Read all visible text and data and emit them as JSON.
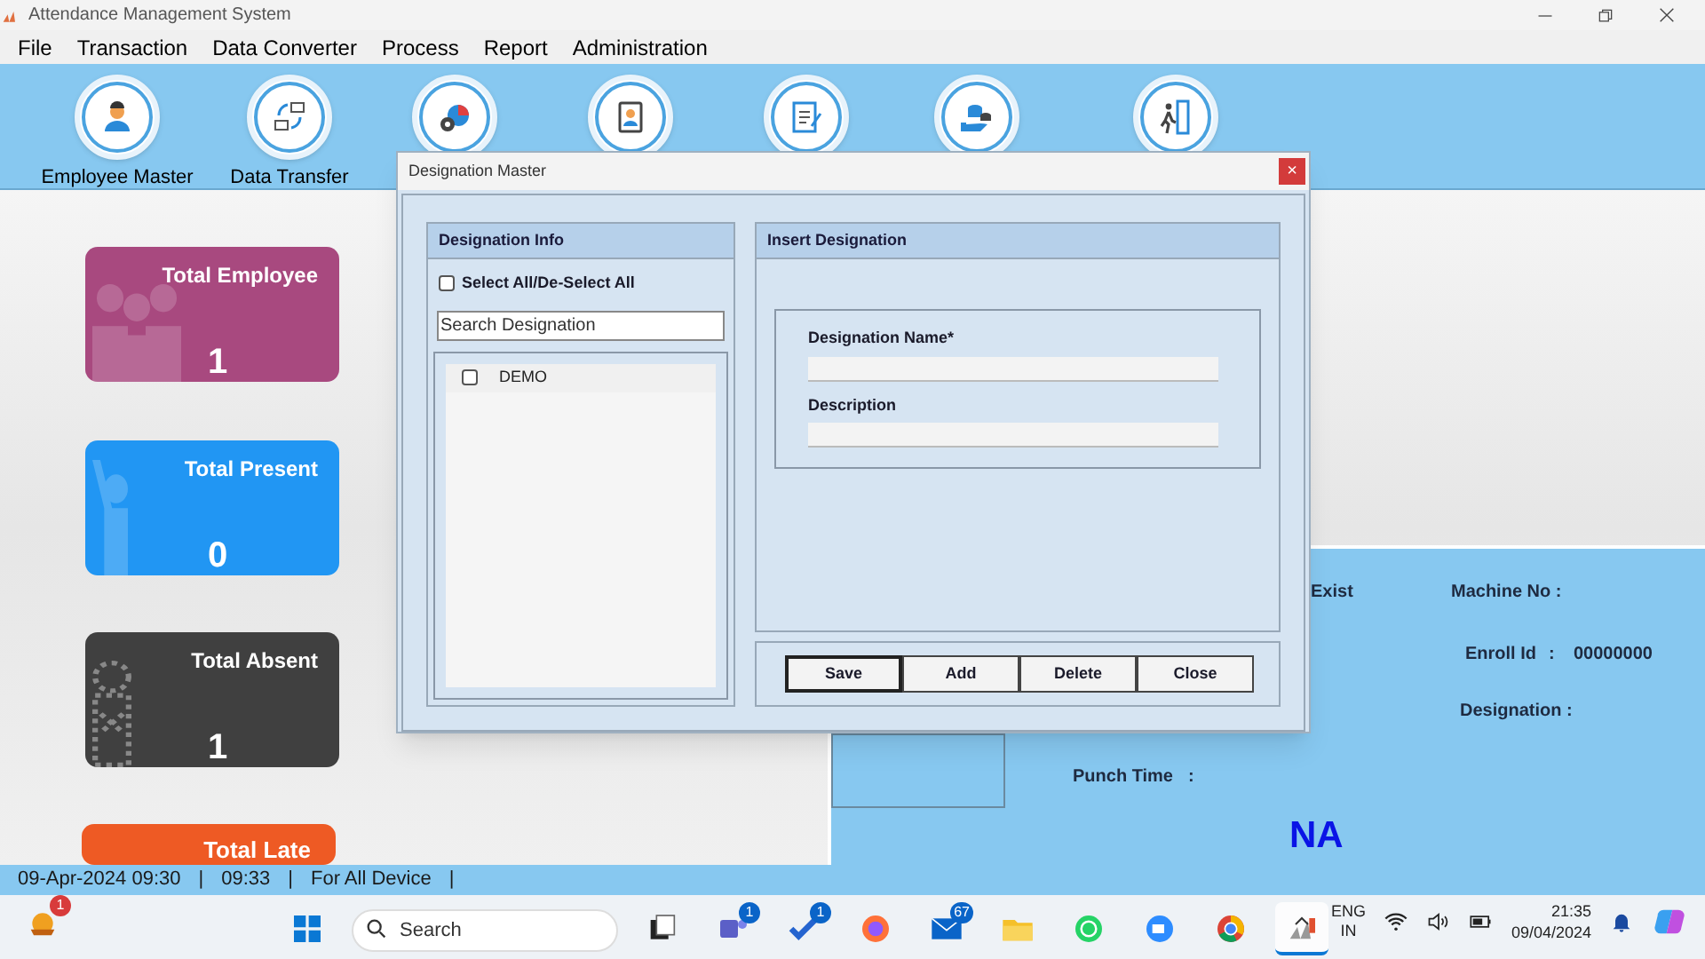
{
  "window": {
    "title": "Attendance Management System"
  },
  "menu": [
    "File",
    "Transaction",
    "Data Converter",
    "Process",
    "Report",
    "Administration"
  ],
  "toolbar": [
    {
      "kind": "employee",
      "label": "Employee Master"
    },
    {
      "kind": "transfer",
      "label": "Data Transfer"
    },
    {
      "kind": "process"
    },
    {
      "kind": "idcard"
    },
    {
      "kind": "report"
    },
    {
      "kind": "money"
    },
    {
      "kind": "exit"
    }
  ],
  "cards": [
    {
      "kind": "employee",
      "title": "Total Employee",
      "count": "1",
      "color": "#a8497f"
    },
    {
      "kind": "present",
      "title": "Total Present",
      "count": "0",
      "color": "#2196f3"
    },
    {
      "kind": "absent",
      "title": "Total Absent",
      "count": "1",
      "color": "#404040"
    },
    {
      "kind": "late",
      "title": "Total Late",
      "color": "#ee5a24"
    }
  ],
  "info_panel": {
    "exist": "Exist",
    "machine_no": "Machine No :",
    "enroll_label": "Enroll Id",
    "enroll_sep": ":",
    "enroll_value": "00000000",
    "designation": "Designation :",
    "punch_label": "Punch Time",
    "punch_sep": ":",
    "status": "NA"
  },
  "dialog": {
    "title": "Designation Master",
    "close": "×",
    "left": {
      "header": "Designation Info",
      "select_all": {
        "label": "Select All/De-Select All",
        "checked": false
      },
      "search": {
        "placeholder": "Search Designation"
      },
      "items": [
        {
          "label": "DEMO",
          "checked": false
        }
      ]
    },
    "right": {
      "header": "Insert Designation",
      "fields": [
        {
          "label": "Designation Name*"
        },
        {
          "label": "Description"
        }
      ]
    },
    "buttons": [
      {
        "label": "Save",
        "selected": true
      },
      {
        "label": "Add",
        "selected": false
      },
      {
        "label": "Delete",
        "selected": false
      },
      {
        "label": "Close",
        "selected": false
      }
    ]
  },
  "status_bar": [
    {
      "text": "09-Apr-2024 09:30",
      "separator": "|"
    },
    {
      "text": "09:33",
      "separator": "|"
    },
    {
      "text": "For All Device",
      "separator": "|"
    }
  ],
  "taskbar": {
    "search": {
      "placeholder": "Search"
    },
    "apps": [
      {
        "kind": "windows"
      },
      {
        "kind": "taskview"
      },
      {
        "kind": "teams",
        "badge": "1"
      },
      {
        "kind": "todo",
        "badge": "1"
      },
      {
        "kind": "firefox"
      },
      {
        "kind": "mail",
        "badge": "67"
      },
      {
        "kind": "files"
      },
      {
        "kind": "whatsapp"
      },
      {
        "kind": "zoom"
      },
      {
        "kind": "chrome"
      },
      {
        "kind": "app",
        "selected": true
      }
    ],
    "weather_badge": "1",
    "lang": "ENG",
    "region": "IN",
    "time": "21:35",
    "date": "09/04/2024"
  }
}
